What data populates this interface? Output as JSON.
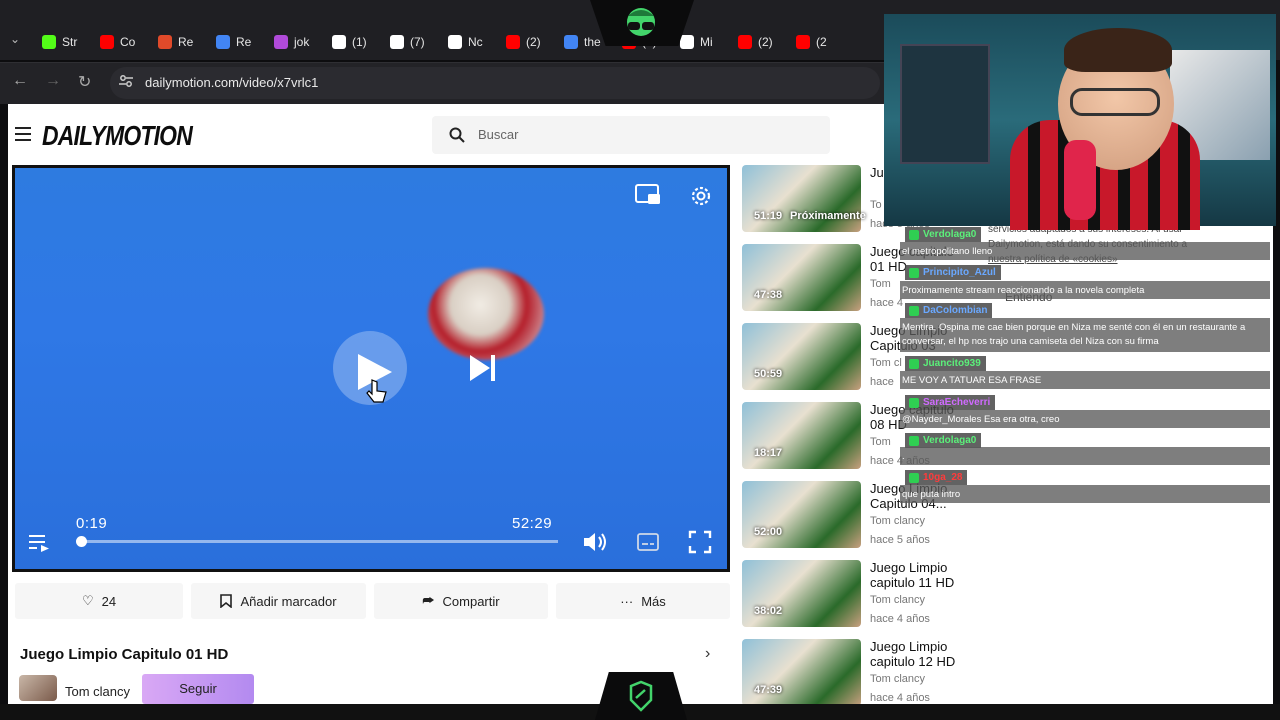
{
  "tabs": [
    {
      "label": "Str",
      "color": "#53fc18"
    },
    {
      "label": "Co",
      "color": "#ff0000"
    },
    {
      "label": "Re",
      "color": "#e04a2a"
    },
    {
      "label": "Re",
      "color": "#4285f4"
    },
    {
      "label": "jok",
      "color": "#b04ad9"
    },
    {
      "label": "(1)",
      "color": "#ffffff"
    },
    {
      "label": "(7)",
      "color": "#ffffff"
    },
    {
      "label": "Nc",
      "color": "#ffffff"
    },
    {
      "label": "(2)",
      "color": "#ff0000"
    },
    {
      "label": "the",
      "color": "#4285f4"
    },
    {
      "label": "(2)",
      "color": "#ff0000"
    },
    {
      "label": "Mi",
      "color": "#ffffff"
    },
    {
      "label": "(2)",
      "color": "#ff0000"
    },
    {
      "label": "(2",
      "color": "#ff0000"
    }
  ],
  "browser": {
    "url": "dailymotion.com/video/x7vrlc1"
  },
  "header": {
    "logo": "DAILYMOTION",
    "search_placeholder": "Buscar"
  },
  "player": {
    "current_time": "0:19",
    "total_time": "52:29",
    "progress_fraction": 0.006
  },
  "actions": {
    "likes": "24",
    "bookmark": "Añadir marcador",
    "share": "Compartir",
    "more": "Más"
  },
  "video": {
    "title": "Juego Limpio Capitulo 01 HD",
    "channel": "Tom clancy",
    "follow": "Seguir"
  },
  "suggestions": [
    {
      "duration": "51:19",
      "badge": "Próximamente",
      "title": "Jue Ca",
      "channel": "To",
      "age": "hace 5 años"
    },
    {
      "duration": "47:38",
      "title": "Juego capitulo 01 HD",
      "channel": "Tom",
      "age": "hace 4"
    },
    {
      "duration": "50:59",
      "title": "Juego Limpio Capitulo 03",
      "channel": "Tom cl",
      "age": "hace"
    },
    {
      "duration": "18:17",
      "title": "Juego capitulo 08 HD",
      "channel": "Tom",
      "age": "hace 4 años"
    },
    {
      "duration": "52:00",
      "title": "Juego Limpio Capitulo 04...",
      "channel": "Tom clancy",
      "age": "hace 5 años"
    },
    {
      "duration": "38:02",
      "title": "Juego Limpio capitulo 11 HD",
      "channel": "Tom clancy",
      "age": "hace 4 años"
    },
    {
      "duration": "47:39",
      "title": "Juego Limpio capitulo 12 HD",
      "channel": "Tom clancy",
      "age": "hace 4 años"
    }
  ],
  "cookie_text": {
    "line1": "servicios adaptados a sus intereses. Al usar",
    "line2": "Dailymotion, está dando su consentimiento a",
    "line3": "nuestra política de «cookies»",
    "button": "Entiendo"
  },
  "chat": [
    {
      "user": "Verdolaga0",
      "color": "#5bf07a",
      "message": "el metropolitano lleno"
    },
    {
      "user": "Principito_Azul",
      "color": "#6aa8ff",
      "message": "Proximamente stream reaccionando a la novela completa"
    },
    {
      "user": "DaColombian",
      "color": "#6aa8ff",
      "message": "Mentira, Ospina me cae bien porque en Niza me senté con él en un restaurante a conversar, el hp nos trajo una camiseta del Niza con su firma"
    },
    {
      "user": "Juancito939",
      "color": "#5bf07a",
      "message": "ME VOY A TATUAR ESA FRASE"
    },
    {
      "user": "SaraEcheverri",
      "color": "#d06aff",
      "message": "@Nayder_Morales Esa era otra, creo"
    },
    {
      "user": "Verdolaga0",
      "color": "#5bf07a",
      "message": "."
    },
    {
      "user": "10ga_28",
      "color": "#ff3b3b",
      "message": "que puta intro"
    }
  ]
}
